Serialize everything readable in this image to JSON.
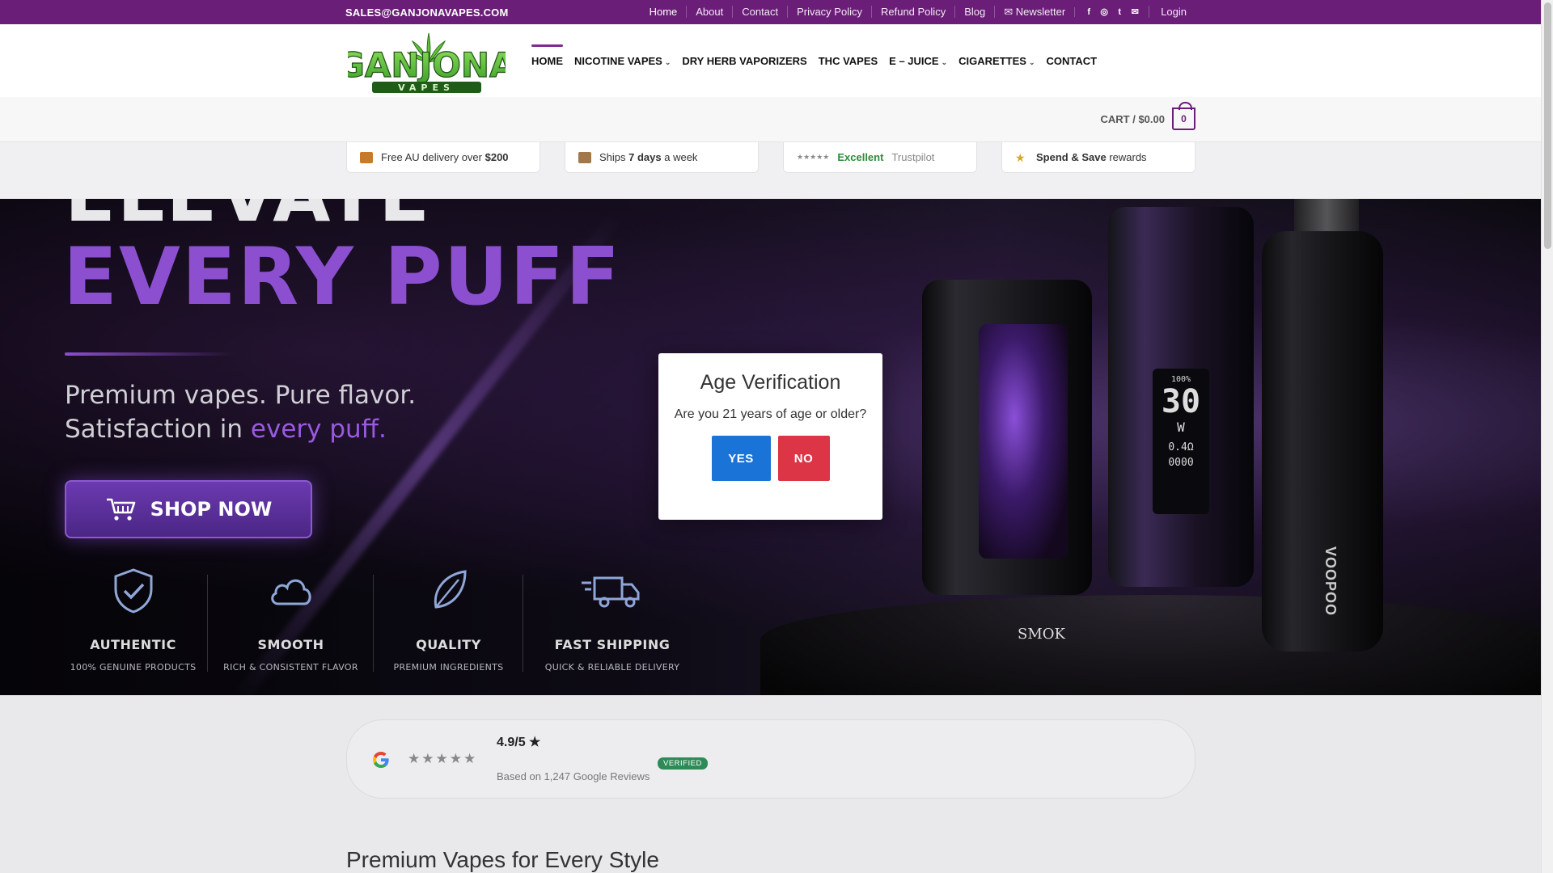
{
  "topbar": {
    "email": "SALES@GANJONAVAPES.COM",
    "links": [
      "Home",
      "About",
      "Contact",
      "Privacy Policy",
      "Refund Policy",
      "Blog"
    ],
    "newsletter": "Newsletter",
    "login": "Login",
    "social_icons": [
      "facebook-icon",
      "instagram-icon",
      "twitter-icon",
      "mail-icon"
    ]
  },
  "header": {
    "logo_text": "GANJONA",
    "logo_sub": "VAPES",
    "nav": [
      {
        "label": "HOME",
        "dropdown": false
      },
      {
        "label": "NICOTINE VAPES",
        "dropdown": true
      },
      {
        "label": "DRY HERB VAPORIZERS",
        "dropdown": false
      },
      {
        "label": "THC VAPES",
        "dropdown": false
      },
      {
        "label": "E – JUICE",
        "dropdown": true
      },
      {
        "label": "CIGARETTES",
        "dropdown": true
      },
      {
        "label": "CONTACT",
        "dropdown": false
      }
    ]
  },
  "cart": {
    "label": "CART / $0.00",
    "count": "0"
  },
  "trust": {
    "delivery_pre": "Free AU delivery over ",
    "delivery_amount": "$200",
    "ships_pre": "Ships ",
    "ships_bold": "7 days",
    "ships_post": " a week",
    "stars": "★★★★★",
    "excellent": "Excellent",
    "trustpilot": "Trustpilot",
    "rewards_bold": "Spend & Save",
    "rewards_post": " rewards"
  },
  "hero": {
    "line1": "ELEVATE",
    "line2": "EVERY PUFF",
    "sub1": "Premium vapes. Pure flavor.",
    "sub2_pre": "Satisfaction in ",
    "sub2_hl": "every puff.",
    "cta": "SHOP NOW",
    "features": [
      {
        "title": "AUTHENTIC",
        "sub": "100% GENUINE PRODUCTS",
        "icon": "shield-check-icon"
      },
      {
        "title": "SMOOTH",
        "sub": "RICH & CONSISTENT FLAVOR",
        "icon": "cloud-icon"
      },
      {
        "title": "QUALITY",
        "sub": "PREMIUM INGREDIENTS",
        "icon": "leaf-icon"
      },
      {
        "title": "FAST SHIPPING",
        "sub": "QUICK & RELIABLE DELIVERY",
        "icon": "truck-icon"
      }
    ],
    "device_brand_1": "SMOK",
    "device_brand_2": "VOOPOO",
    "device_screen_battery": "100%",
    "device_screen_watt": "30",
    "device_screen_unit": "W",
    "device_screen_ohm": "0.4Ω",
    "device_screen_puffs": "0000"
  },
  "modal": {
    "title": "Age Verification",
    "question": "Are you 21 years of age or older?",
    "yes": "YES",
    "no": "NO"
  },
  "reviews": {
    "stars": "★★★★★",
    "score": "4.9/5 ★",
    "verified": "VERIFIED",
    "based_on": "Based on 1,247 Google Reviews"
  },
  "section_title": "Premium Vapes for Every Style",
  "colors": {
    "brand_purple": "#6a1e77",
    "accent_violet": "#8b4fd0",
    "yes_blue": "#1a73d6",
    "no_red": "#dc3545",
    "verified_green": "#2e8b57"
  }
}
